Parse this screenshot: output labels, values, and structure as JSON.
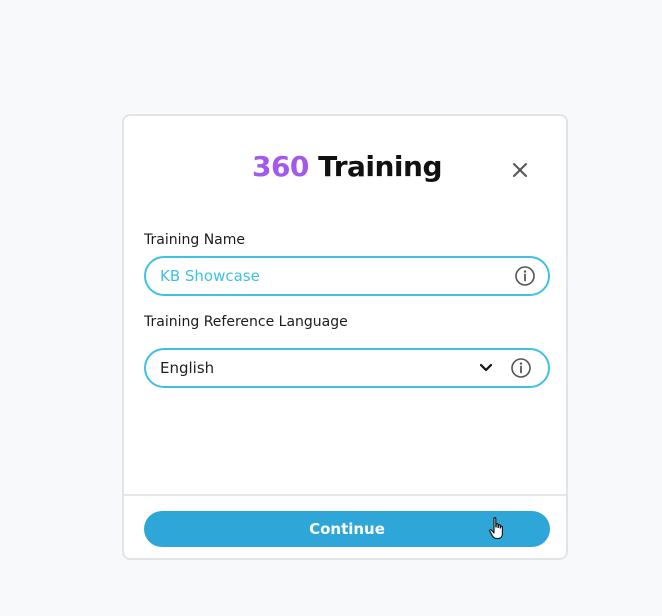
{
  "dialog": {
    "title_number": "360",
    "title_word": "Training",
    "close_icon": "close-icon"
  },
  "training_name": {
    "label": "Training Name",
    "value": "KB Showcase",
    "info_icon": "info-icon"
  },
  "reference_language": {
    "label": "Training Reference Language",
    "selected": "English",
    "dropdown_icon": "chevron-down-icon",
    "info_icon": "info-icon"
  },
  "footer": {
    "continue_label": "Continue"
  },
  "colors": {
    "accent_purple": "#a259ee",
    "field_border": "#3ec1e4",
    "button_bg": "#2ea7d8"
  }
}
